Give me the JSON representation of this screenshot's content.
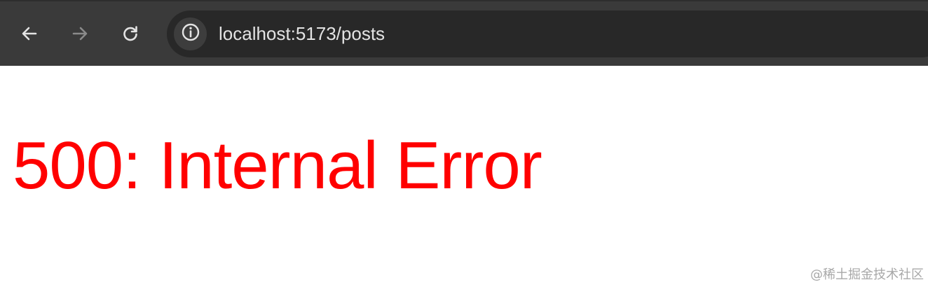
{
  "browser": {
    "address_bar": {
      "url": "localhost:5173/posts"
    },
    "icons": {
      "back": "back-arrow-icon",
      "forward": "forward-arrow-icon",
      "reload": "reload-icon",
      "site_info": "info-circle-icon"
    }
  },
  "page": {
    "error_heading": "500: Internal Error",
    "error_color": "#ff0000"
  },
  "watermark": {
    "text": "@稀土掘金技术社区"
  }
}
